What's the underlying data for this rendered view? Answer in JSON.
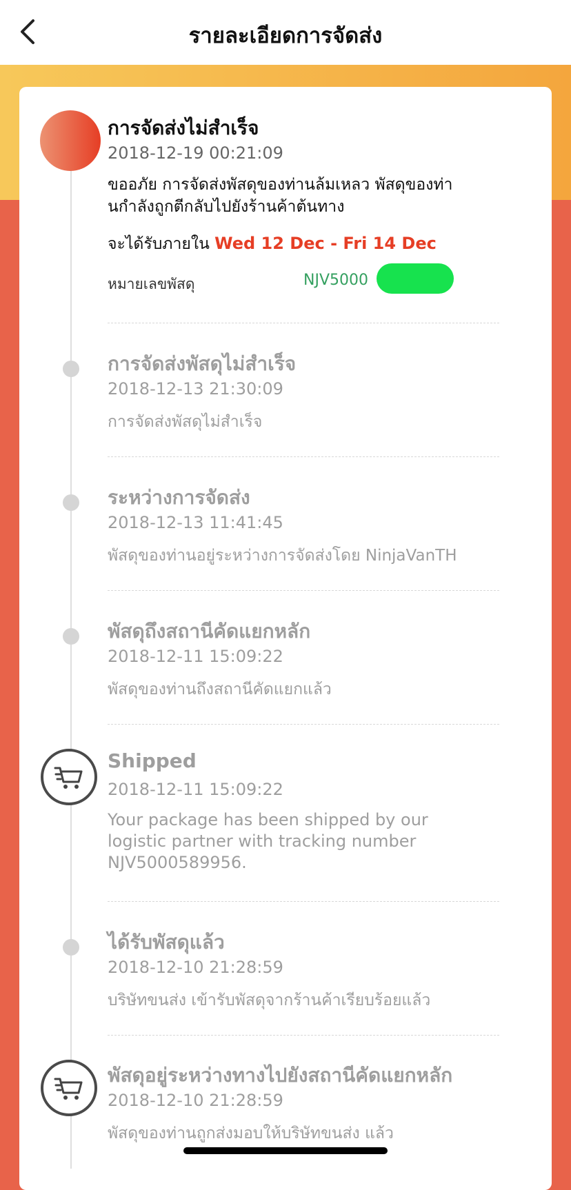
{
  "header": {
    "title": "รายละเอียดการจัดส่ง",
    "back_icon": "chevron-left-icon"
  },
  "colors": {
    "accent_red": "#e63e25",
    "band_start": "#f7c85a",
    "band_end": "#f4a63d",
    "page_bg": "#e8634a",
    "tracking_green": "#35a060",
    "redaction": "#17e24e"
  },
  "current_status": {
    "title": "การจัดส่งไม่สำเร็จ",
    "time": "2018-12-19 00:21:09",
    "desc_line1": "ขออภัย การจัดส่งพัสดุของท่านล้มเหลว พัสดุของท่า",
    "desc_line2": "นกำลังถูกตีกลับไปยังร้านค้าต้นทาง",
    "eta_label": "จะได้รับภายใน",
    "eta_range": "Wed 12 Dec - Fri 14 Dec",
    "parcel_label": "หมายเลขพัสดุ",
    "parcel_number": "NJV5000"
  },
  "events": [
    {
      "title": "การจัดส่งพัสดุไม่สำเร็จ",
      "time": "2018-12-13 21:30:09",
      "desc": "การจัดส่งพัสดุไม่สำเร็จ",
      "icon": "timeline-dot"
    },
    {
      "title": "ระหว่างการจัดส่ง",
      "time": "2018-12-13 11:41:45",
      "desc": "พัสดุของท่านอยู่ระหว่างการจัดส่งโดย NinjaVanTH",
      "icon": "timeline-dot"
    },
    {
      "title": "พัสดุถึงสถานีคัดแยกหลัก",
      "time": "2018-12-11 15:09:22",
      "desc": "พัสดุของท่านถึงสถานีคัดแยกแล้ว",
      "icon": "timeline-dot"
    },
    {
      "title": "Shipped",
      "time": "2018-12-11 15:09:22",
      "desc_line1": "Your package has been shipped by our",
      "desc_line2": "logistic partner with tracking number",
      "desc_line3": "NJV5000589956.",
      "icon": "shopping-cart-icon"
    },
    {
      "title": "ได้รับพัสดุแล้ว",
      "time": "2018-12-10 21:28:59",
      "desc": "บริษัทขนส่ง เข้ารับพัสดุจากร้านค้าเรียบร้อยแล้ว",
      "icon": "timeline-dot"
    },
    {
      "title": "พัสดุอยู่ระหว่างทางไปยังสถานีคัดแยกหลัก",
      "time": "2018-12-10 21:28:59",
      "desc": "พัสดุของท่านถูกส่งมอบให้บริษัทขนส่ง  แล้ว",
      "icon": "shopping-cart-icon"
    }
  ]
}
